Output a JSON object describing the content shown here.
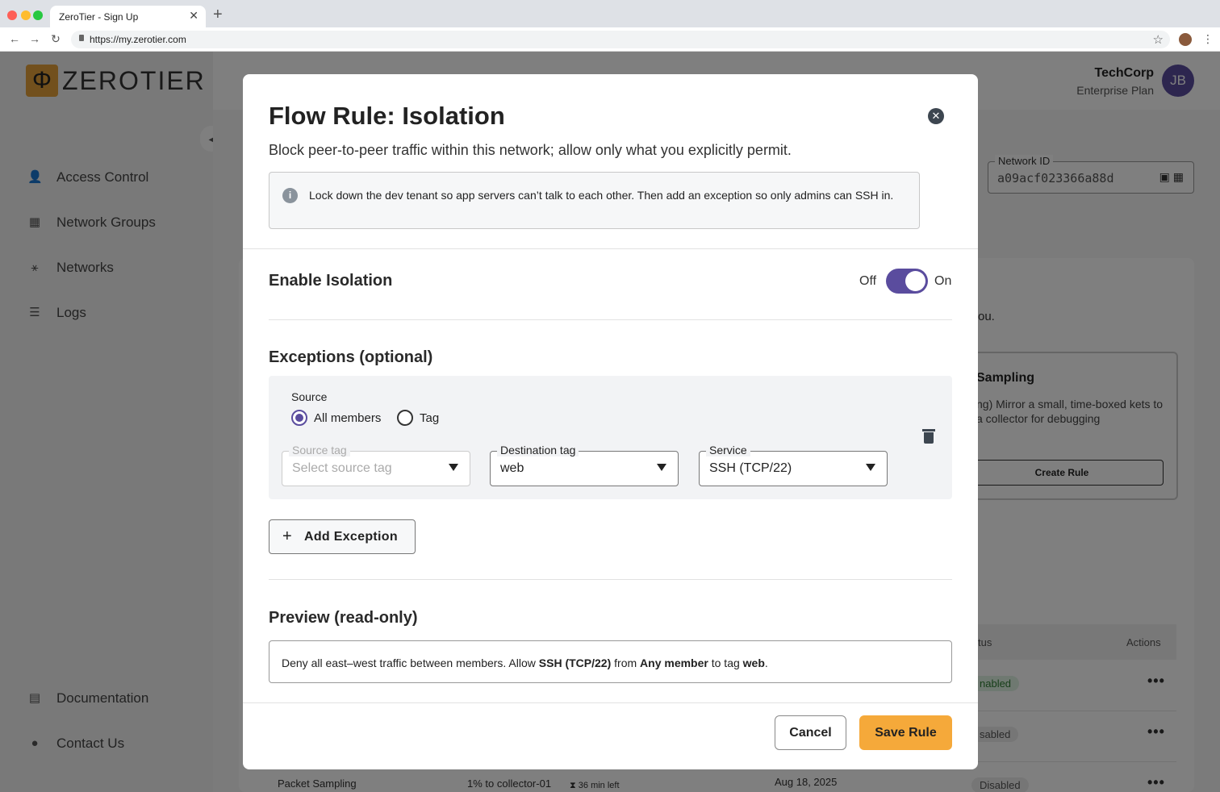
{
  "browser": {
    "tab_title": "ZeroTier - Sign Up",
    "url": "https://my.zerotier.com"
  },
  "app": {
    "logo_text": "ZEROTIER",
    "logo_symbol": "Φ",
    "sidebar": {
      "items": [
        {
          "label": "Access Control",
          "icon": "user-gear-icon"
        },
        {
          "label": "Network Groups",
          "icon": "building-icon"
        },
        {
          "label": "Networks",
          "icon": "network-icon"
        },
        {
          "label": "Logs",
          "icon": "list-icon"
        }
      ],
      "bottom_items": [
        {
          "label": "Documentation",
          "icon": "document-icon"
        },
        {
          "label": "Contact Us",
          "icon": "help-icon"
        }
      ]
    },
    "header": {
      "org_name": "TechCorp",
      "plan": "Enterprise Plan",
      "avatar_initials": "JB"
    },
    "network_id": {
      "label": "Network ID",
      "value": "a09acf023366a88d"
    },
    "background": {
      "partial_text": "ou.",
      "template_title": "Sampling",
      "template_desc": "ng) Mirror a small, time-boxed kets to a collector for debugging",
      "template_button": "Create Rule",
      "table_status_header": "tus",
      "table_actions_header": "Actions",
      "rows": [
        {
          "status": "nabled",
          "type": "on"
        },
        {
          "status": "sabled",
          "type": "off"
        },
        {
          "status": "Disabled",
          "type": "off"
        }
      ],
      "bottom_row": {
        "name": "Packet Sampling",
        "target": "1% to collector-01",
        "timer": "36 min left",
        "date": "Aug 18, 2025"
      }
    }
  },
  "modal": {
    "title": "Flow Rule: Isolation",
    "subtitle": "Block peer-to-peer traffic within this network; allow only what you explicitly permit.",
    "info": "Lock down the dev tenant so app servers can’t talk to each other. Then add an exception so only admins can SSH in.",
    "enable": {
      "heading": "Enable Isolation",
      "off_label": "Off",
      "on_label": "On",
      "enabled": true
    },
    "exceptions": {
      "heading": "Exceptions (optional)",
      "source_label": "Source",
      "source_options": [
        "All members",
        "Tag"
      ],
      "source_selected": "All members",
      "source_tag": {
        "label": "Source tag",
        "placeholder": "Select source tag"
      },
      "destination_tag": {
        "label": "Destination tag",
        "value": "web"
      },
      "service": {
        "label": "Service",
        "value": "SSH (TCP/22)"
      },
      "add_button": "Add Exception"
    },
    "preview": {
      "heading": "Preview (read-only)",
      "part1": "Deny all east–west traffic between members. Allow ",
      "service": "SSH (TCP/22)",
      "part2": " from ",
      "source": "Any member",
      "part3": " to tag ",
      "tag": "web",
      "part4": "."
    },
    "buttons": {
      "cancel": "Cancel",
      "save": "Save Rule"
    }
  }
}
